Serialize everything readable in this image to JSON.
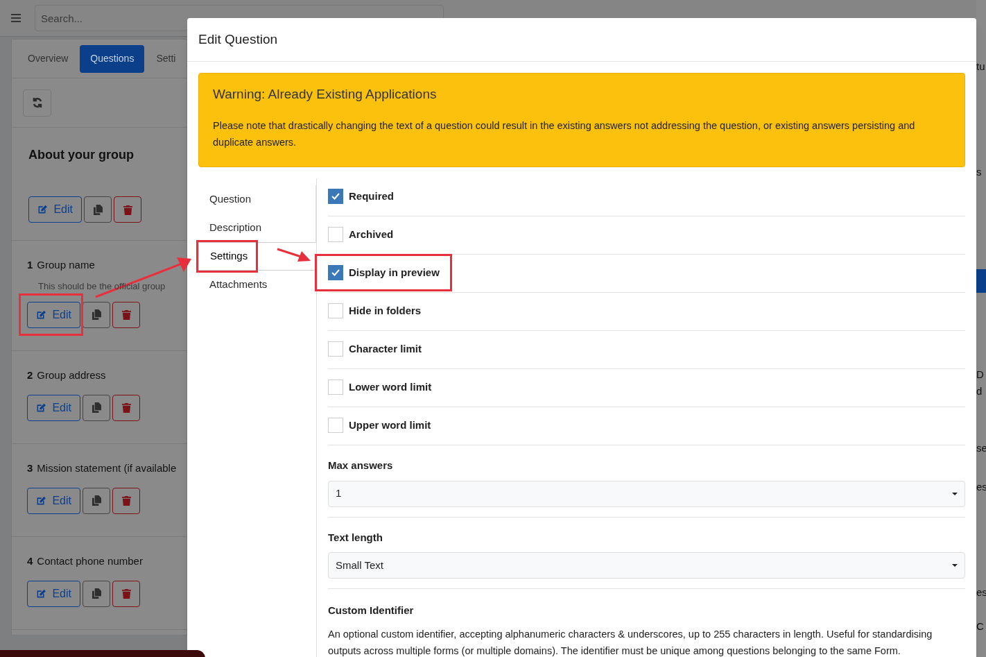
{
  "topbar": {
    "search_placeholder": "Search..."
  },
  "page_tabs": [
    {
      "label": "Overview",
      "selected": false
    },
    {
      "label": "Questions",
      "selected": true
    },
    {
      "label": "Setti",
      "selected": false
    }
  ],
  "section": {
    "title": "About your group",
    "edit_label": "Edit"
  },
  "questions": [
    {
      "number": "1",
      "title": "Group name",
      "hint": "This should be the official group",
      "highlighted": true,
      "edit_label": "Edit"
    },
    {
      "number": "2",
      "title": "Group address",
      "highlighted": false,
      "edit_label": "Edit"
    },
    {
      "number": "3",
      "title": "Mission statement (if available",
      "highlighted": false,
      "edit_label": "Edit"
    },
    {
      "number": "4",
      "title": "Contact phone number",
      "highlighted": false,
      "edit_label": "Edit"
    }
  ],
  "right_fragments": [
    "tu",
    "s",
    "D",
    "d",
    "se",
    "es",
    "es",
    "C"
  ],
  "modal": {
    "title": "Edit Question",
    "warning": {
      "title": "Warning: Already Existing Applications",
      "text": "Please note that drastically changing the text of a question could result in the existing answers not addressing the question, or existing answers persisting and duplicate answers."
    },
    "nav": [
      {
        "label": "Question",
        "selected": false,
        "highlighted": false
      },
      {
        "label": "Description",
        "selected": false,
        "highlighted": false
      },
      {
        "label": "Settings",
        "selected": true,
        "highlighted": true
      },
      {
        "label": "Attachments",
        "selected": false,
        "highlighted": false
      }
    ],
    "options": [
      {
        "label": "Required",
        "checked": true,
        "highlighted": false
      },
      {
        "label": "Archived",
        "checked": false,
        "highlighted": false
      },
      {
        "label": "Display in preview",
        "checked": true,
        "highlighted": true
      },
      {
        "label": "Hide in folders",
        "checked": false,
        "highlighted": false
      },
      {
        "label": "Character limit",
        "checked": false,
        "highlighted": false
      },
      {
        "label": "Lower word limit",
        "checked": false,
        "highlighted": false
      },
      {
        "label": "Upper word limit",
        "checked": false,
        "highlighted": false
      }
    ],
    "selects": [
      {
        "label": "Max answers",
        "value": "1"
      },
      {
        "label": "Text length",
        "value": "Small Text"
      }
    ],
    "custom_identifier": {
      "label": "Custom Identifier",
      "text": "An optional custom identifier, accepting alphanumeric characters & underscores, up to 255 characters in length. Useful for standardising outputs across multiple forms (or multiple domains). The identifier must be unique among questions belonging to the same Form."
    }
  }
}
